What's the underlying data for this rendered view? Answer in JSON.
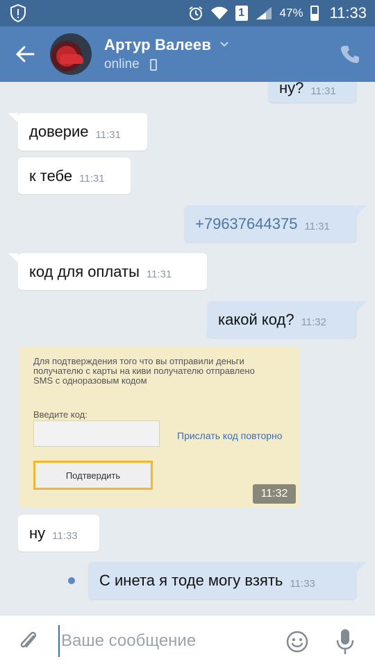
{
  "status_bar": {
    "sim_slot": "1",
    "battery": "47%",
    "time": "11:33",
    "icons": [
      "shield-alert-icon",
      "alarm-icon",
      "wifi-icon",
      "sim-icon",
      "signal-icon",
      "battery-icon"
    ]
  },
  "header": {
    "name": "Артур Валеев",
    "status": "online",
    "icons": [
      "back-arrow-icon",
      "chevron-down-icon",
      "mobile-icon",
      "phone-icon"
    ]
  },
  "messages": [
    {
      "direction": "out",
      "text": "ну?",
      "time": "11:31"
    },
    {
      "direction": "in",
      "text": "доверие",
      "time": "11:31"
    },
    {
      "direction": "in",
      "text": "к тебе",
      "time": "11:31"
    },
    {
      "direction": "out",
      "text": "+79637644375",
      "time": "11:31"
    },
    {
      "direction": "in",
      "text": "код для оплаты",
      "time": "11:31"
    },
    {
      "direction": "out",
      "text": "какой код?",
      "time": "11:32"
    },
    {
      "direction": "in",
      "text": "ну",
      "time": "11:33"
    },
    {
      "direction": "out",
      "text": "С инета я тоде могу взять",
      "time": "11:33"
    }
  ],
  "photo": {
    "text": "Для подтверждения того что вы отправили деньги получателю с карты на киви получателю отправлено SMS с одноразовым кодом",
    "code_label": "Введите код:",
    "resend": "Прислать код повторно",
    "confirm": "Подтвердить",
    "time": "11:32"
  },
  "composer": {
    "placeholder": "Ваше сообщение",
    "icons": [
      "paperclip-icon",
      "emoji-icon",
      "microphone-icon"
    ]
  },
  "colors": {
    "header": "#5181b8",
    "status_bar": "#3e6895",
    "chat_background": "#e6ebf0",
    "outgoing_bubble": "#d5e3f2",
    "incoming_bubble": "#ffffff",
    "link": "#4c77a6"
  }
}
